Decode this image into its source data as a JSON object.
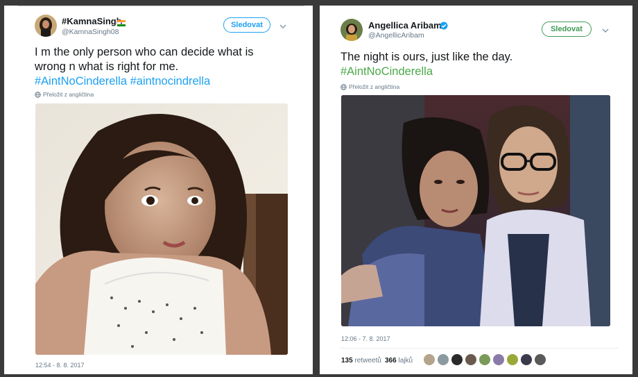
{
  "left_tweet": {
    "author_name": "#KamnaSingh",
    "flag_icon": "indian-flag-icon",
    "handle": "@KamnaSingh08",
    "follow_label": "Sledovat",
    "text_main": "I m the only person who can decide what is wrong n what is right for me.",
    "hashtag_1": "#AintNoCinderella",
    "hashtag_2": "#aintnocindrella",
    "translate_label": "Přeložit z angličtina",
    "timestamp": "12:54 - 8. 8. 2017",
    "colors": {
      "accent": "#1da1f2",
      "follow_border": "#1da1f2"
    }
  },
  "right_tweet": {
    "author_name": "Angellica Aribam",
    "verified_icon": "verified-badge-icon",
    "handle": "@AngellicAribam",
    "follow_label": "Sledovat",
    "text_main": "The night is ours, just like the day.",
    "hashtag": "#AintNoCinderella",
    "translate_label": "Přeložit z angličtina",
    "timestamp": "12:06 - 7. 8. 2017",
    "retweets_count": "135",
    "retweets_label": "retweetů",
    "likes_count": "366",
    "likes_label": "lajků",
    "colors": {
      "accent": "#1da1f2",
      "hashtag": "#4aa84a",
      "follow": "#3f9b52"
    }
  }
}
